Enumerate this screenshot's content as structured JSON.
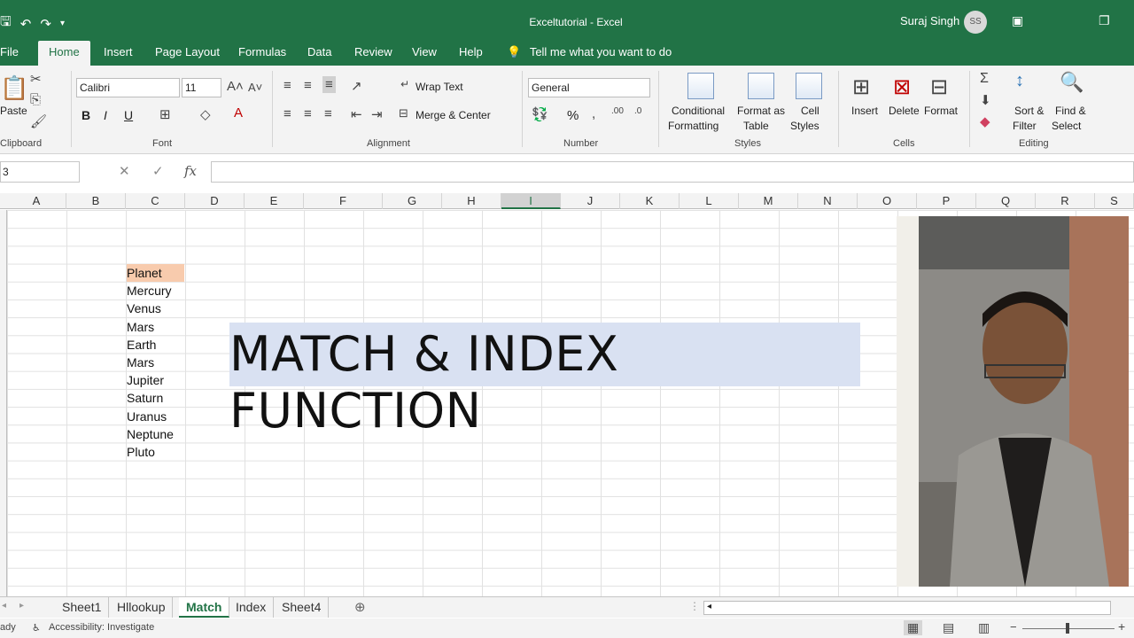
{
  "window": {
    "title": "Exceltutorial  -  Excel",
    "user": "Suraj Singh",
    "avatar": "SS"
  },
  "tabs": [
    {
      "label": "File"
    },
    {
      "label": "Home"
    },
    {
      "label": "Insert"
    },
    {
      "label": "Page Layout"
    },
    {
      "label": "Formulas"
    },
    {
      "label": "Data"
    },
    {
      "label": "Review"
    },
    {
      "label": "View"
    },
    {
      "label": "Help"
    }
  ],
  "tell_me": "Tell me what you want to do",
  "ribbon": {
    "clipboard": {
      "paste": "Paste",
      "label": "Clipboard"
    },
    "font": {
      "name": "Calibri",
      "size": "11",
      "label": "Font",
      "bold": "B",
      "italic": "I",
      "underline": "U"
    },
    "alignment": {
      "wrap": "Wrap Text",
      "merge": "Merge & Center",
      "label": "Alignment"
    },
    "number": {
      "format": "General",
      "percent": "%",
      "comma": "͕",
      "label": "Number"
    },
    "styles": {
      "conditional_1": "Conditional",
      "conditional_2": "Formatting",
      "format_table_1": "Format as",
      "format_table_2": "Table",
      "cell_styles_1": "Cell",
      "cell_styles_2": "Styles",
      "label": "Styles"
    },
    "cells": {
      "insert": "Insert",
      "delete": "Delete",
      "format": "Format",
      "label": "Cells"
    },
    "editing": {
      "sort_1": "Sort &",
      "sort_2": "Filter",
      "find_1": "Find &",
      "find_2": "Select",
      "label": "Editing"
    }
  },
  "formula_bar": {
    "name_box": "3",
    "fx": "fx",
    "value": ""
  },
  "columns": [
    "A",
    "B",
    "C",
    "D",
    "E",
    "F",
    "G",
    "H",
    "I",
    "J",
    "K",
    "L",
    "M",
    "N",
    "O",
    "P",
    "Q",
    "R",
    "S"
  ],
  "selected_column": "I",
  "planets": [
    "Planet",
    "Mercury",
    "Venus",
    "Mars",
    "Earth",
    "Mars",
    "Jupiter",
    "Saturn",
    "Uranus",
    "Neptune",
    "Pluto"
  ],
  "banner": "MATCH & INDEX FUNCTION",
  "sheets": [
    "Sheet1",
    "Hllookup",
    "Match",
    "Index",
    "Sheet4"
  ],
  "active_sheet": "Match",
  "status": {
    "ready": "ady",
    "accessibility": "Accessibility: Investigate"
  },
  "colors": {
    "excel_green": "#217346",
    "header_fill": "#f8cbad",
    "banner_fill": "#d9e1f2"
  }
}
